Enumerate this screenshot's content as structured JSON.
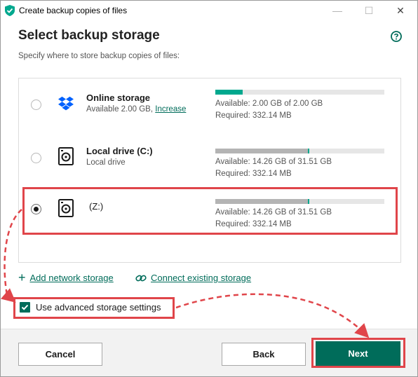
{
  "window": {
    "title": "Create backup copies of files",
    "controls": {
      "minimize": "—",
      "maximize": "☐",
      "close": "✕"
    }
  },
  "header": {
    "title": "Select backup storage",
    "subtitle": "Specify where to store backup copies of files:",
    "help_icon": "help-circle-icon"
  },
  "storages": [
    {
      "name": "Online storage",
      "desc": "Available 2.00 GB,",
      "desc_link": "Increase",
      "icon": "dropbox-icon",
      "used_fraction": 0.16,
      "used_color": "#00a88e",
      "available": "Available: 2.00 GB of 2.00 GB",
      "required": "Required: 332.14 MB",
      "selected": false
    },
    {
      "name": "Local drive (C:)",
      "desc": "Local drive",
      "icon": "hard-drive-icon",
      "used_fraction": 0.547,
      "used_color": "#b4b4b4",
      "available": "Available: 14.26 GB of 31.51 GB",
      "required": "Required: 332.14 MB",
      "selected": false
    },
    {
      "name": "(Z:)",
      "icon": "hard-drive-icon",
      "used_fraction": 0.547,
      "used_color": "#b4b4b4",
      "available": "Available: 14.26 GB of 31.51 GB",
      "required": "Required: 332.14 MB",
      "selected": true
    }
  ],
  "links": {
    "add_network": "Add network storage",
    "connect_existing": "Connect existing storage"
  },
  "advanced": {
    "label": "Use advanced storage settings",
    "checked": true
  },
  "buttons": {
    "cancel": "Cancel",
    "back": "Back",
    "next": "Next"
  },
  "colors": {
    "accent": "#006c5a",
    "highlight": "#e0454a"
  }
}
